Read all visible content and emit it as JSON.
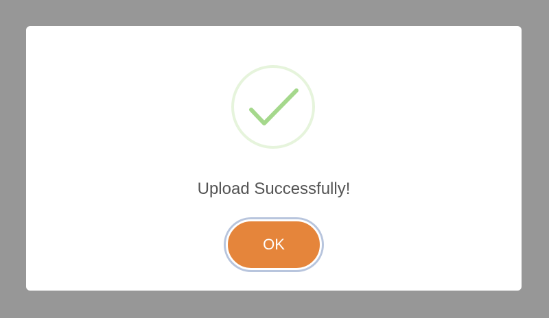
{
  "dialog": {
    "icon": "success-checkmark-icon",
    "message": "Upload Successfully!",
    "confirm_label": "OK"
  },
  "colors": {
    "overlay": "#979797",
    "dialog_background": "#ffffff",
    "icon_ring": "#e6f4dc",
    "icon_check": "#a5d88c",
    "message_text": "#545454",
    "button_background": "#e5853b",
    "button_focus_ring": "#b8c5dd",
    "button_text": "#ffffff"
  }
}
